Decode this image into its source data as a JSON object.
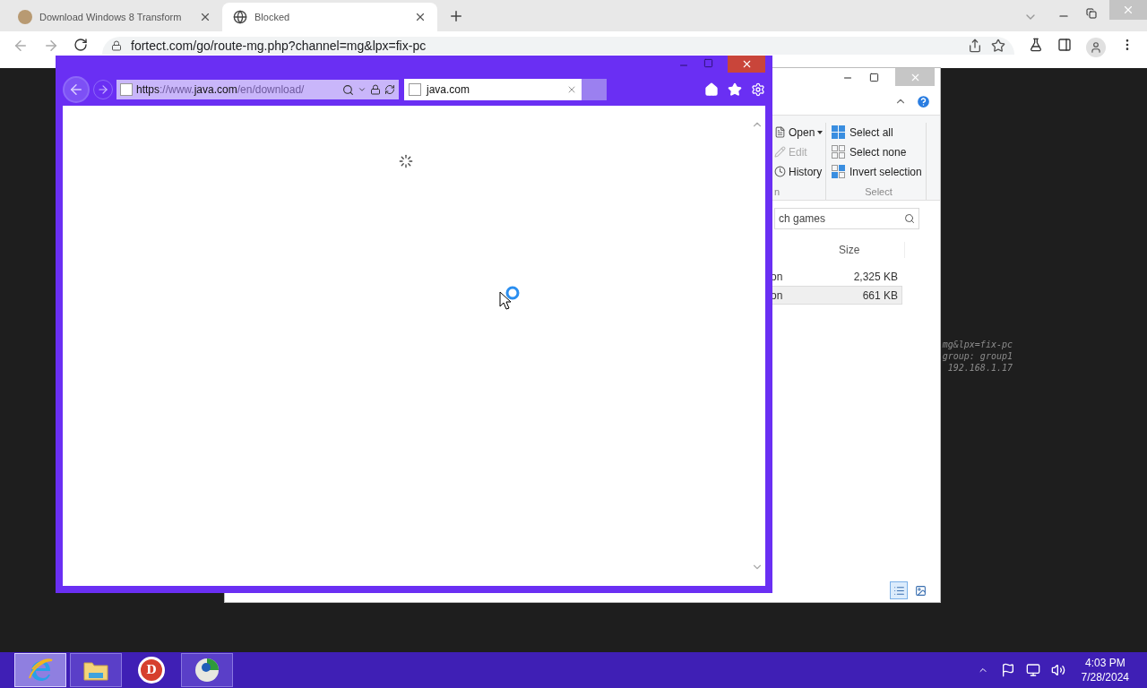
{
  "browser": {
    "tabs": [
      {
        "title": "Download Windows 8 Transform",
        "selected": false
      },
      {
        "title": "Blocked",
        "selected": true
      }
    ],
    "address": "fortect.com/go/route-mg.php?channel=mg&lpx=fix-pc"
  },
  "explorer": {
    "open_group": {
      "label": "n",
      "items": [
        {
          "label": "Open",
          "kind": "dropdown",
          "disabled": false
        },
        {
          "label": "Edit",
          "kind": "edit",
          "disabled": true
        },
        {
          "label": "History",
          "kind": "history",
          "disabled": false
        }
      ]
    },
    "select_group": {
      "label": "Select",
      "items": [
        {
          "label": "Select all",
          "kind": "all"
        },
        {
          "label": "Select none",
          "kind": "none"
        },
        {
          "label": "Invert selection",
          "kind": "invert"
        }
      ]
    },
    "search": {
      "value": "ch games"
    },
    "columns": [
      "Size"
    ],
    "rows": [
      {
        "column_1": "on",
        "size": "2,325 KB",
        "selected": false
      },
      {
        "column_1": "on",
        "size": "661 KB",
        "selected": true
      }
    ],
    "views": [
      {
        "kind": "details",
        "selected": true
      },
      {
        "kind": "large_icons",
        "selected": false
      }
    ]
  },
  "overlay_text": [
    "mg&lpx=fix-pc",
    "group: group1",
    "192.168.1.17"
  ],
  "ie": {
    "url": [
      {
        "text": "https",
        "emphasis": true
      },
      {
        "text": "://www.",
        "emphasis": false
      },
      {
        "text": "java.com",
        "emphasis": true
      },
      {
        "text": "/en/download/",
        "emphasis": false
      }
    ],
    "tabs": [
      {
        "title": "java.com",
        "selected": true
      }
    ]
  },
  "taskbar": {
    "apps": [
      {
        "kind": "ie",
        "active": true,
        "running": true
      },
      {
        "kind": "explorer",
        "active": false,
        "running": true
      },
      {
        "kind": "letter",
        "label": "D",
        "active": false,
        "running": false
      },
      {
        "kind": "globe",
        "active": false,
        "running": true
      }
    ],
    "time": "4:03 PM",
    "date": "7/28/2024"
  }
}
